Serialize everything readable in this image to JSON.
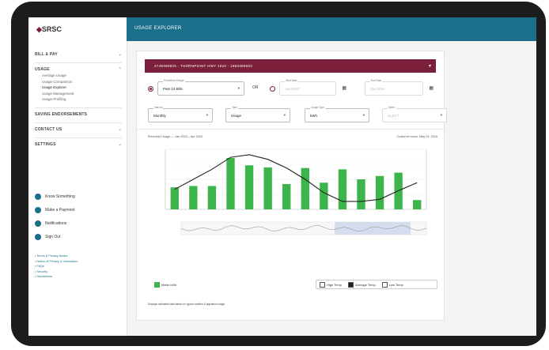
{
  "logo": {
    "text": "SRSC"
  },
  "sidebar": {
    "sections": [
      {
        "label": "BILL & PAY"
      },
      {
        "label": "USAGE",
        "items": [
          "Average Usage",
          "Usage Comparison",
          "Usage Explorer",
          "Usage Management",
          "Usage Profiling"
        ]
      },
      {
        "label": "SAVING ENDORSEMENTS"
      },
      {
        "label": "CONTACT US"
      },
      {
        "label": "SETTINGS"
      }
    ],
    "actions": [
      "Know Something",
      "Make a Payment",
      "Notifications",
      "Sign Out"
    ],
    "links": [
      "Terms & Privacy Notice",
      "Notice of Privacy & Information",
      "FAQs",
      "Security",
      "Disclaimers"
    ]
  },
  "topbar": {
    "title": "USAGE EXPLORER"
  },
  "account": {
    "text": "2749490825 - THORNPOINT HWY 1042 - 1983488503"
  },
  "filters": {
    "range_label": "Predefined Range",
    "range_value": "Past 13 Bills",
    "or": "OR",
    "start_label": "Start Date",
    "start_value": "Jan 2023",
    "end_label": "End Date",
    "end_value": "Jan 2024",
    "interval_label": "Interval",
    "interval_value": "Monthly",
    "type_label": "Type",
    "type_value": "Usage",
    "unit_label": "Usage Type",
    "unit_value": "kWh",
    "meter_label": "Meter",
    "meter_value": "ELECT"
  },
  "chart_head": {
    "left": "Electricity Usage — Jan 2023 – Apr 2024",
    "right": "Customer since: May 24, 2016"
  },
  "chart_data": {
    "type": "bar",
    "categories": [
      "",
      "",
      "",
      "",
      "",
      "",
      "",
      "",
      "",
      "",
      "",
      "",
      "",
      ""
    ],
    "series": [
      {
        "values": [
          33,
          35,
          35,
          77,
          66,
          63,
          38,
          62,
          40,
          60,
          45,
          50,
          55,
          14
        ]
      },
      {
        "values": [
          30,
          45,
          60,
          78,
          82,
          75,
          62,
          45,
          25,
          12,
          12,
          15,
          28,
          40
        ]
      }
    ],
    "ylim": [
      0,
      90
    ]
  },
  "legend": {
    "meter": "Meter",
    "kwh": "kWh"
  },
  "temp_legend": {
    "high": "High Temp",
    "avg": "Average Temp",
    "low": "Low Temp"
  },
  "footnote": "Displays estimated data based on typical weather & appliance usage.",
  "colors": {
    "brand": "#7b1f3a",
    "header": "#1c6f8a",
    "bar": "#3cb54a",
    "line": "#222222"
  }
}
